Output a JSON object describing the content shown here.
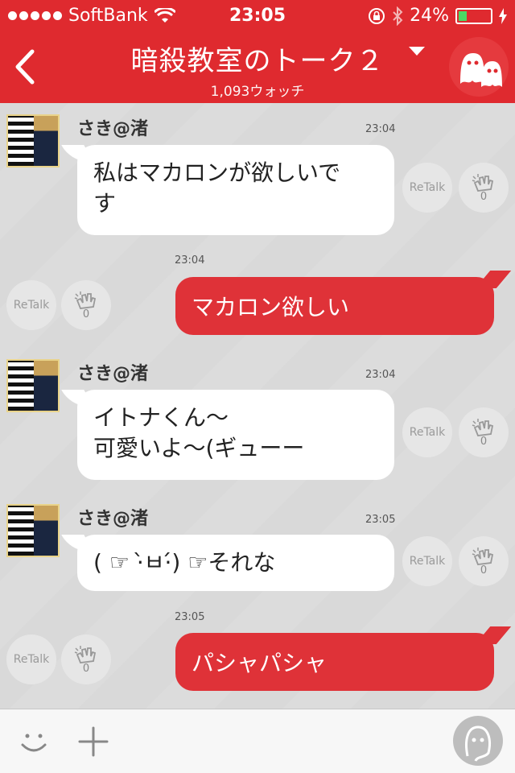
{
  "status_bar": {
    "carrier": "SoftBank",
    "time": "23:05",
    "battery_level": "24%"
  },
  "header": {
    "title": "暗殺教室のトーク２",
    "watch_count": "1,093ウォッチ"
  },
  "icons": [
    "chevron-left-icon",
    "dropdown-arrow-icon",
    "ghost-icon",
    "wifi-icon",
    "lock-rotation-icon",
    "bluetooth-icon",
    "battery-icon",
    "charging-icon",
    "clap-icon",
    "smile-icon",
    "plus-icon",
    "face-icon"
  ],
  "messages": [
    {
      "sender": "さき@渚",
      "time": "23:04",
      "text_line1": "私はマカロンが欲しいで",
      "text_line2": "す",
      "retalk": "ReTalk",
      "claps": "0"
    },
    {
      "time": "23:04",
      "text": "マカロン欲しい",
      "retalk": "ReTalk",
      "claps": "0"
    },
    {
      "sender": "さき@渚",
      "time": "23:04",
      "text_line1": "イトナくん〜",
      "text_line2": "可愛いよ〜(ギューー",
      "retalk": "ReTalk",
      "claps": "0"
    },
    {
      "sender": "さき@渚",
      "time": "23:05",
      "text": "( ☞ ·̀ㅂ·́) ☞それな",
      "retalk": "ReTalk",
      "claps": "0"
    },
    {
      "time": "23:05",
      "text": "パシャパシャ",
      "retalk": "ReTalk",
      "claps": "0"
    }
  ],
  "colors": {
    "brand_red": "#df2a2f",
    "outgoing_bubble": "#df3238",
    "incoming_bubble": "#ffffff",
    "chat_background": "#d9d9d9"
  }
}
